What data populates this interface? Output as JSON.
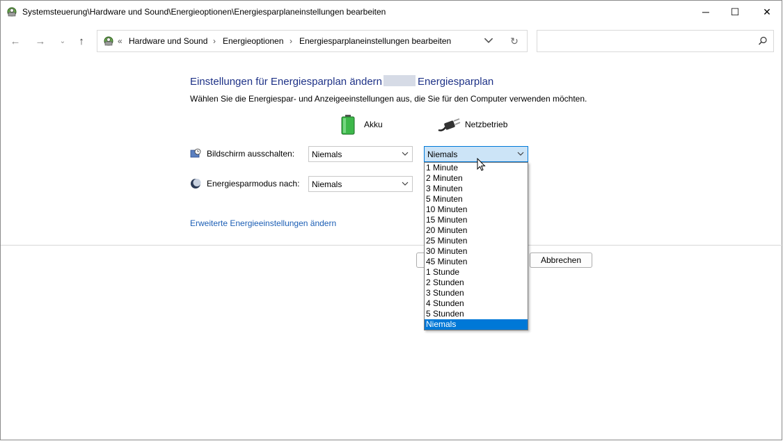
{
  "window": {
    "title": "Systemsteuerung\\Hardware und Sound\\Energieoptionen\\Energiesparplaneinstellungen bearbeiten",
    "min_glyph": "─",
    "max_glyph": "☐",
    "close_glyph": "✕"
  },
  "nav": {
    "back_glyph": "←",
    "forward_glyph": "→",
    "recent_glyph": "⌄",
    "up_glyph": "↑",
    "overflow": "«",
    "breadcrumbs": [
      "Hardware und Sound",
      "Energieoptionen",
      "Energiesparplaneinstellungen bearbeiten"
    ],
    "separator": "›",
    "refresh_glyph": "↻",
    "search_placeholder": ""
  },
  "content": {
    "heading_prefix": "Einstellungen für Energiesparplan ändern",
    "heading_suffix": "Energiesparplan",
    "subtext": "Wählen Sie die Energiespar- und Anzeigeeinstellungen aus, die Sie für den Computer verwenden möchten.",
    "col_battery": "Akku",
    "col_plugged": "Netzbetrieb",
    "rows": [
      {
        "label": "Bildschirm ausschalten:",
        "battery": "Niemals",
        "plugged": "Niemals"
      },
      {
        "label": "Energiesparmodus nach:",
        "battery": "Niemals"
      }
    ],
    "advanced_link": "Erweiterte Energieeinstellungen ändern",
    "cancel_button": "Abbrechen"
  },
  "dropdown": {
    "options": [
      "1 Minute",
      "2 Minuten",
      "3 Minuten",
      "5 Minuten",
      "10 Minuten",
      "15 Minuten",
      "20 Minuten",
      "25 Minuten",
      "30 Minuten",
      "45 Minuten",
      "1 Stunde",
      "2 Stunden",
      "3 Stunden",
      "4 Stunden",
      "5 Stunden",
      "Niemals"
    ],
    "selected": "Niemals"
  },
  "colors": {
    "heading": "#1e3287",
    "link": "#1b5eb5",
    "selection": "#0078d7",
    "active_combo": "#cce4f7"
  },
  "icons": [
    "control-panel-icon",
    "battery-icon",
    "power-plug-icon",
    "display-clock-icon",
    "moon-icon",
    "search-icon",
    "chevron-down-icon"
  ]
}
